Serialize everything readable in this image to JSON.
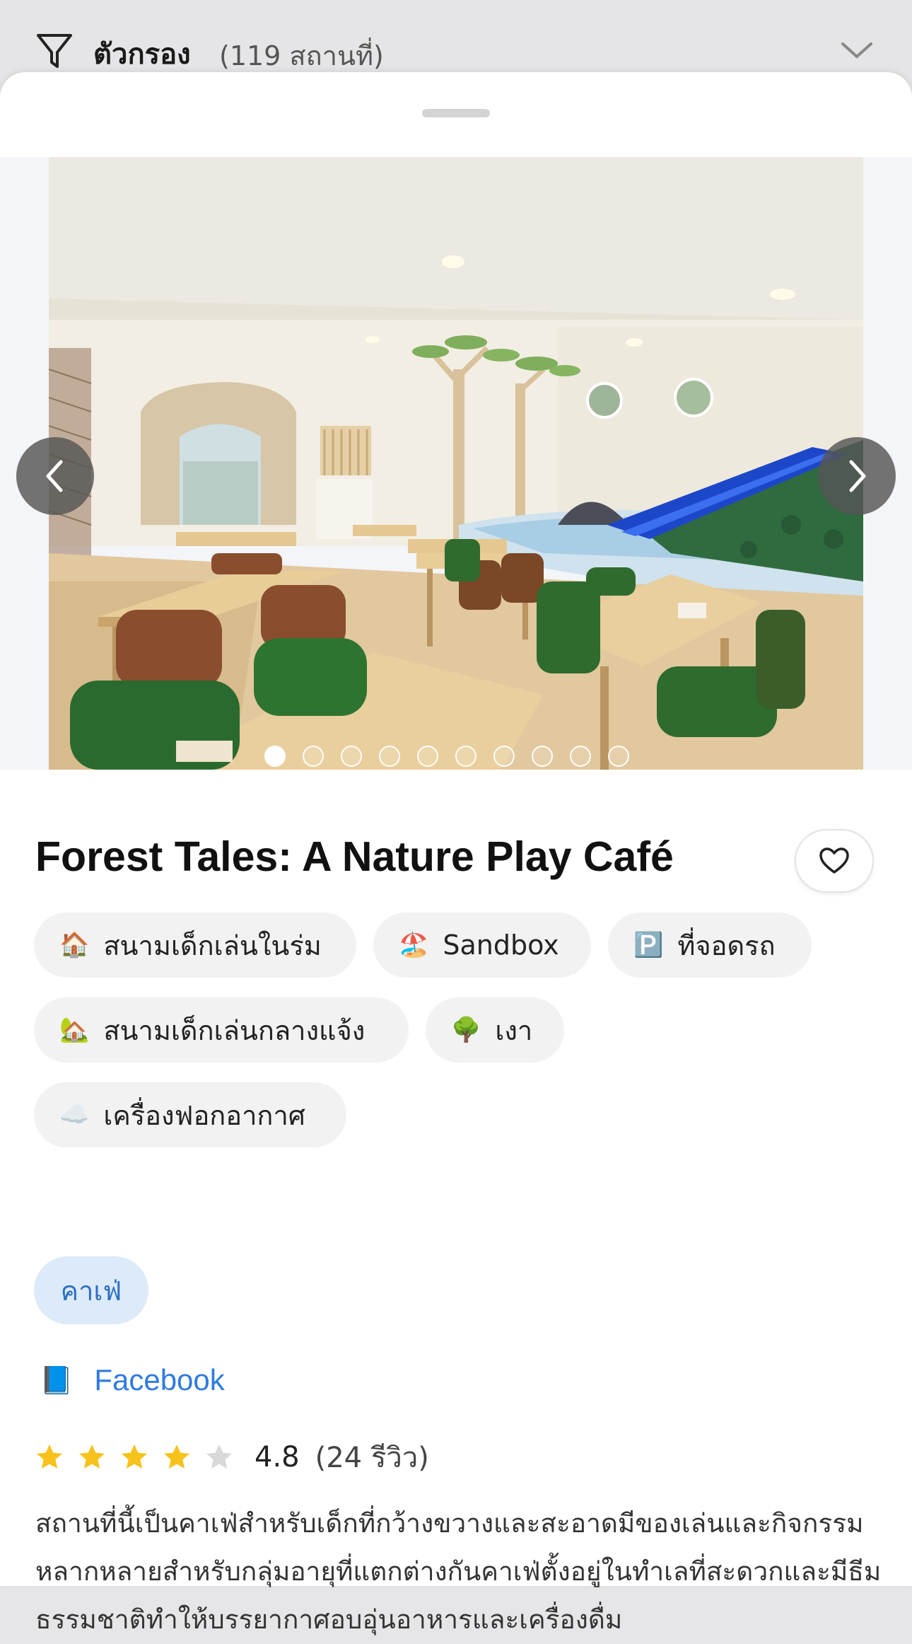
{
  "filter": {
    "title": "ตัวกรอง",
    "count": "(119 สถานที่)",
    "icon": "filter-icon",
    "toggle_icon": "chevron-down-icon"
  },
  "gallery": {
    "photo_count": 10,
    "active_index": 0,
    "prev_icon": "chevron-left-icon",
    "next_icon": "chevron-right-icon"
  },
  "place": {
    "name": "Forest Tales: A Nature Play Café",
    "favorite_icon": "heart-icon",
    "amenities": [
      {
        "emoji": "🏠",
        "label": "สนามเด็กเล่นในร่ม"
      },
      {
        "emoji": "🏖️",
        "label": "Sandbox"
      },
      {
        "emoji": "🅿️",
        "label": "ที่จอดรถ"
      },
      {
        "emoji": "🏡",
        "label": "สนามเด็กเล่นกลางแจ้ง"
      },
      {
        "emoji": "🌳",
        "label": "เงา"
      },
      {
        "emoji": "☁️",
        "label": "เครื่องฟอกอากาศ"
      }
    ],
    "category": "คาเฟ่",
    "link": {
      "emoji": "📘",
      "label": "Facebook"
    },
    "rating": {
      "stars_filled": 4,
      "stars_total": 5,
      "value": "4.8",
      "reviews": "(24 รีวิว)"
    },
    "description": "สถานที่นี้เป็นคาเฟ่สำหรับเด็กที่กว้างขวางและสะอาดมีของเล่นและกิจกรรมหลากหลายสำหรับกลุ่มอายุที่แตกต่างกันคาเฟ่ตั้งอยู่ในทำเลที่สะดวกและมีธีมธรรมชาติทำให้บรรยากาศอบอุ่นอาหารและเครื่องดื่ม"
  },
  "colors": {
    "accent_blue": "#2f7be0",
    "category_bg": "#dceaf9",
    "star": "#f7c21b",
    "star_empty": "#d9d9d9"
  }
}
